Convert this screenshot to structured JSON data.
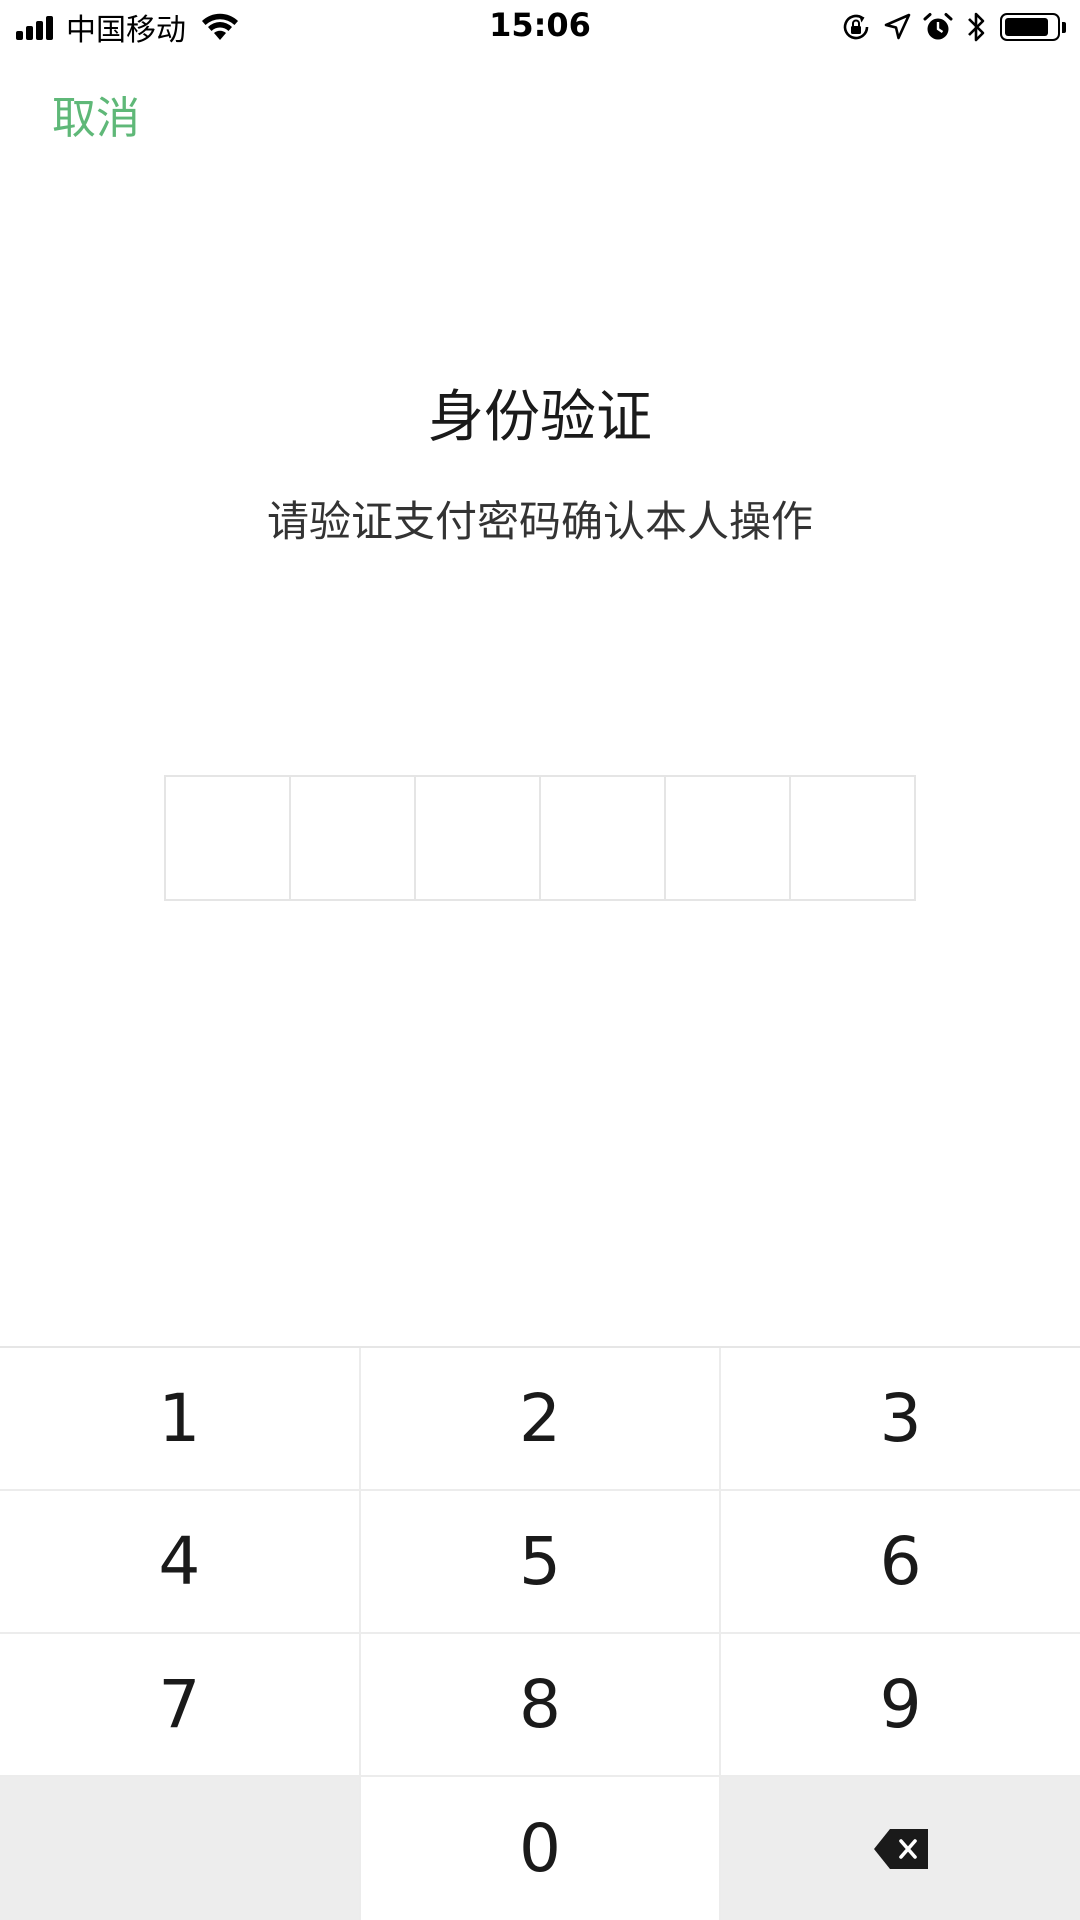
{
  "status_bar": {
    "carrier": "中国移动",
    "time": "15:06",
    "signal_icon": "cellular-signal-icon",
    "wifi_icon": "wifi-icon",
    "icons": [
      "rotation-lock-icon",
      "location-arrow-icon",
      "alarm-icon",
      "bluetooth-icon"
    ],
    "battery_level": 0.85
  },
  "header": {
    "cancel_label": "取消"
  },
  "content": {
    "title": "身份验证",
    "subtitle": "请验证支付密码确认本人操作"
  },
  "pin": {
    "length": 6,
    "filled": 0
  },
  "keypad": {
    "rows": [
      [
        "1",
        "2",
        "3"
      ],
      [
        "4",
        "5",
        "6"
      ],
      [
        "7",
        "8",
        "9"
      ],
      [
        "",
        "0",
        "delete-icon"
      ]
    ]
  },
  "colors": {
    "accent": "#5fb878",
    "key_gray": "#ededed",
    "border": "#e5e5e5"
  }
}
